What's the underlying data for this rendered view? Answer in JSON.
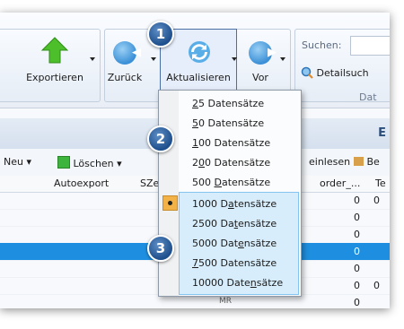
{
  "ribbon": {
    "export_label": "Exportieren",
    "back_label": "Zurück",
    "refresh_label": "Aktualisieren",
    "forward_label": "Vor",
    "search_label": "Suchen:",
    "detail_search_label": "Detailsuch",
    "group_caption_partial": "Dat"
  },
  "band": {
    "letter": "E"
  },
  "toolbar": {
    "new_label": "Neu",
    "delete_label": "Löschen",
    "import_label": "einlesen",
    "bez_label": "Be"
  },
  "columns": [
    "Autoexport",
    "SZe",
    "order_...",
    "Te"
  ],
  "rows": [
    {
      "order": "0",
      "te": "0"
    },
    {
      "order": "0",
      "te": ""
    },
    {
      "order": "0",
      "te": ""
    },
    {
      "order": "0",
      "te": "",
      "selected": true
    },
    {
      "order": "0",
      "te": ""
    },
    {
      "order": "0",
      "te": "0"
    },
    {
      "order": "0",
      "te": ""
    }
  ],
  "peek_text": "MR",
  "menu": {
    "items": [
      {
        "pre": "",
        "key": "2",
        "post": "5 Datensätze"
      },
      {
        "pre": "",
        "key": "5",
        "post": "0 Datensätze"
      },
      {
        "pre": "",
        "key": "1",
        "post": "00 Datensätze"
      },
      {
        "pre": "2",
        "key": "0",
        "post": "0 Datensätze"
      },
      {
        "pre": "500 ",
        "key": "D",
        "post": "atensätze",
        "checked": true
      },
      {
        "pre": "1000 D",
        "key": "a",
        "post": "tensätze"
      },
      {
        "pre": "2500 Da",
        "key": "t",
        "post": "ensätze"
      },
      {
        "pre": "5000 Dat",
        "key": "e",
        "post": "nsätze"
      },
      {
        "pre": "",
        "key": "7",
        "post": "500 Datensätze"
      },
      {
        "pre": "10000 Date",
        "key": "n",
        "post": "sätze"
      }
    ]
  },
  "callouts": [
    "1",
    "2",
    "3"
  ],
  "colors": {
    "accent": "#1e8fe0",
    "highlight": "#d7edfb",
    "check": "#f2b248",
    "callout": "#1e4f8c"
  }
}
